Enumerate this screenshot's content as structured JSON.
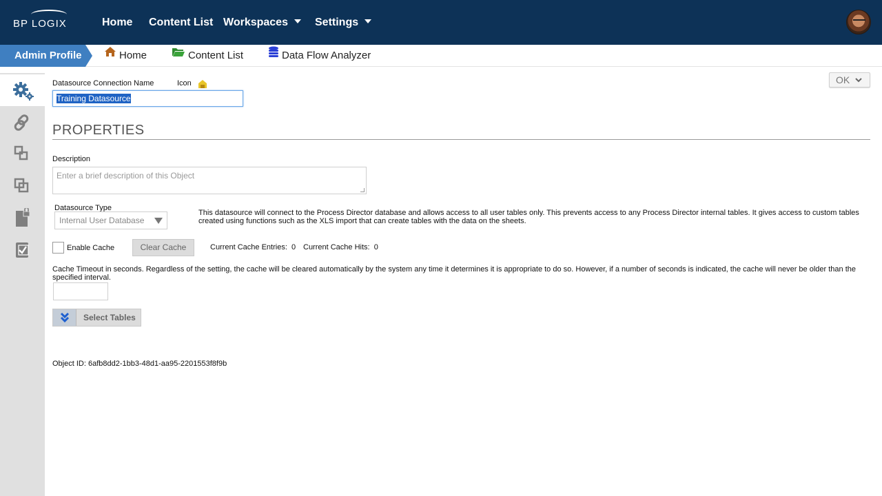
{
  "topnav": {
    "logo": "BP LOGIX",
    "items": [
      {
        "label": "Home",
        "has_caret": false
      },
      {
        "label": "Content List",
        "has_caret": false
      },
      {
        "label": "Workspaces",
        "has_caret": true
      },
      {
        "label": "Settings",
        "has_caret": true
      }
    ],
    "avatar": "user-avatar"
  },
  "subnav": {
    "active": "Admin Profile",
    "links": [
      {
        "label": "Home",
        "icon": "home-icon"
      },
      {
        "label": "Content List",
        "icon": "folder-icon"
      },
      {
        "label": "Data Flow Analyzer",
        "icon": "database-icon"
      }
    ]
  },
  "sidebar": {
    "items": [
      {
        "icon": "gears-icon",
        "active": true
      },
      {
        "icon": "link-icon",
        "active": false
      },
      {
        "icon": "diagram-icon",
        "active": false
      },
      {
        "icon": "copy-icon",
        "active": false
      },
      {
        "icon": "locked-document-icon",
        "active": false
      },
      {
        "icon": "checklist-icon",
        "active": false
      }
    ]
  },
  "form": {
    "connection_name_label": "Datasource Connection Name",
    "icon_label": "Icon",
    "connection_name_value": "Training Datasource",
    "ok_label": "OK",
    "section_title": "PROPERTIES",
    "description_label": "Description",
    "description_placeholder": "Enter a brief description of this Object",
    "datasource_type_label": "Datasource Type",
    "datasource_type_value": "Internal User Database",
    "datasource_help": "This datasource will connect to the Process Director database and allows access to all user tables only. This prevents access to any Process Director internal tables. It gives access to custom tables created using functions such as the XLS import that can create tables with the data on the sheets.",
    "enable_cache_label": "Enable Cache",
    "clear_cache_label": "Clear Cache",
    "cache_entries_label": "Current Cache Entries:",
    "cache_entries_value": "0",
    "cache_hits_label": "Current Cache Hits:",
    "cache_hits_value": "0",
    "timeout_text": "Cache Timeout in seconds. Regardless of the setting, the cache will be cleared automatically by the system any time it determines it is appropriate to do so. However, if a number of seconds is indicated, the cache will never be older than the specified interval.",
    "timeout_value": "",
    "select_tables_label": "Select Tables",
    "object_id_text": "Object ID: 6afb8dd2-1bb3-48d1-aa95-2201553f8f9b"
  },
  "colors": {
    "topbar": "#0d3257",
    "active_tab": "#3f7fc1",
    "sidebar": "#e0e0e0",
    "icon_color": "#3c6e9c",
    "home_icon": "#b5651d",
    "folder_icon": "#2e8b2e",
    "database_icon": "#2a3fd6"
  }
}
